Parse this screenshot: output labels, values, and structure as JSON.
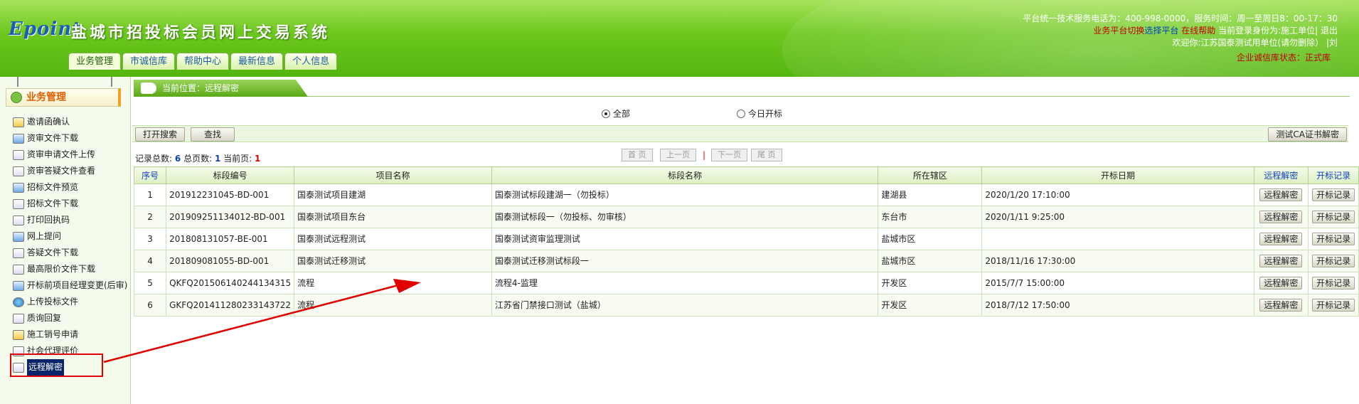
{
  "header": {
    "logo": "Epoint",
    "title": "盐城市招投标会员网上交易系统",
    "tabs": [
      "业务管理",
      "市诚信库",
      "帮助中心",
      "最新信息",
      "个人信息"
    ],
    "line1": "平台统一技术服务电话为：400-998-0000，服务时间：周一至周日8：00-17：30",
    "switch_label": "业务平台切换",
    "select_platform": "选择平台",
    "online_help": "在线帮助",
    "identity": "当前登录身份为:施工单位",
    "logout": "退出",
    "welcome": "欢迎你:江苏国泰测试用单位(请勿删除） |刘",
    "status_label": "企业诚信库状态：",
    "status_value": "正式库"
  },
  "sidebar": {
    "heading": "业务管理",
    "items": [
      {
        "label": "邀请函确认",
        "icon": "handshake-icon"
      },
      {
        "label": "资审文件下载",
        "icon": "document-edit-icon"
      },
      {
        "label": "资审申请文件上传",
        "icon": "user-upload-icon"
      },
      {
        "label": "资审答疑文件查看",
        "icon": "user-doc-icon"
      },
      {
        "label": "招标文件预览",
        "icon": "preview-icon"
      },
      {
        "label": "招标文件下载",
        "icon": "download-icon"
      },
      {
        "label": "打印回执码",
        "icon": "print-icon"
      },
      {
        "label": "网上提问",
        "icon": "question-icon"
      },
      {
        "label": "答疑文件下载",
        "icon": "document-icon"
      },
      {
        "label": "最高限价文件下载",
        "icon": "user-doc-icon"
      },
      {
        "label": "开标前项目经理变更(后审)",
        "icon": "edit-icon"
      },
      {
        "label": "上传投标文件",
        "icon": "globe-icon"
      },
      {
        "label": "质询回复",
        "icon": "folder-icon"
      },
      {
        "label": "施工销号申请",
        "icon": "note-icon"
      },
      {
        "label": "社会代理评价",
        "icon": "chat-icon"
      },
      {
        "label": "远程解密",
        "icon": "folder-icon"
      }
    ]
  },
  "breadcrumb": "当前位置：远程解密",
  "filters": {
    "all": "全部",
    "today": "今日开标"
  },
  "toolbar": {
    "open_search": "打开搜索",
    "find": "查找",
    "ca_decrypt": "测试CA证书解密"
  },
  "pager": {
    "total_label": "记录总数:",
    "total": "6",
    "pages_label": "总页数:",
    "pages": "1",
    "current_label": "当前页:",
    "current": "1",
    "first": "首 页",
    "prev": "上一页",
    "sep": "|",
    "next": "下一页",
    "last": "尾 页"
  },
  "table": {
    "columns": [
      "序号",
      "标段编号",
      "项目名称",
      "标段名称",
      "所在辖区",
      "开标日期",
      "远程解密",
      "开标记录"
    ],
    "rows": [
      {
        "no": "1",
        "code": "201912231045-BD-001",
        "project": "国泰测试项目建湖",
        "section": "国泰测试标段建湖一（勿投标）",
        "district": "建湖县",
        "date": "2020/1/20 17:10:00",
        "decrypt": "远程解密",
        "record": "开标记录"
      },
      {
        "no": "2",
        "code": "201909251134012-BD-001",
        "project": "国泰测试项目东台",
        "section": "国泰测试标段一（勿投标、勿审核）",
        "district": "东台市",
        "date": "2020/1/11 9:25:00",
        "decrypt": "远程解密",
        "record": "开标记录"
      },
      {
        "no": "3",
        "code": "201808131057-BE-001",
        "project": "国泰测试远程测试",
        "section": "国泰测试资审监理测试",
        "district": "盐城市区",
        "date": "",
        "decrypt": "远程解密",
        "record": "开标记录"
      },
      {
        "no": "4",
        "code": "201809081055-BD-001",
        "project": "国泰测试迁移测试",
        "section": "国泰测试迁移测试标段一",
        "district": "盐城市区",
        "date": "2018/11/16 17:30:00",
        "decrypt": "远程解密",
        "record": "开标记录"
      },
      {
        "no": "5",
        "code": "QKFQ201506140244134315",
        "project": "流程",
        "section": "流程4-监理",
        "district": "开发区",
        "date": "2015/7/7 15:00:00",
        "decrypt": "远程解密",
        "record": "开标记录"
      },
      {
        "no": "6",
        "code": "GKFQ201411280233143722",
        "project": "流程",
        "section": "江苏省门禁接口测试（盐城）",
        "district": "开发区",
        "date": "2018/7/12 17:50:00",
        "decrypt": "远程解密",
        "record": "开标记录"
      }
    ]
  },
  "colors": {
    "header_green": "#6bc71c",
    "annotation_red": "#e00000",
    "link_blue": "#1040c0"
  }
}
